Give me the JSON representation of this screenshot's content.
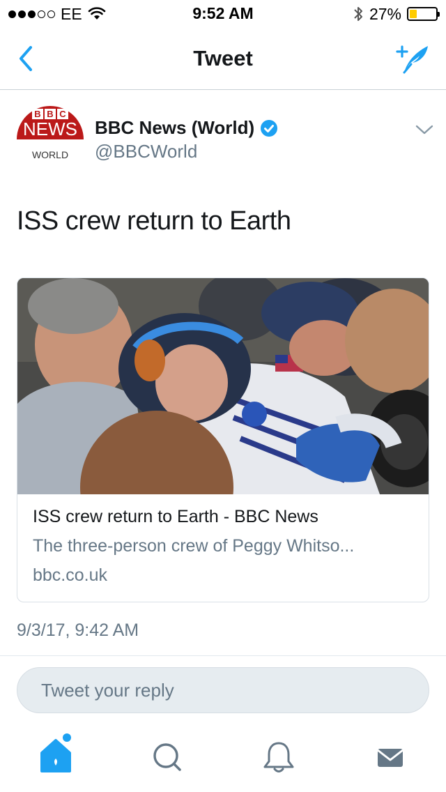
{
  "status_bar": {
    "carrier": "EE",
    "time": "9:52 AM",
    "battery_percent": "27%",
    "battery_level": 0.27,
    "signal_bars_filled": 3,
    "signal_bars_total": 5
  },
  "nav": {
    "title": "Tweet",
    "back_icon": "chevron-left-icon",
    "compose_icon": "compose-tweet-icon",
    "accent_color": "#1da1f2"
  },
  "tweet": {
    "author_name": "BBC News (World)",
    "author_handle": "@BBCWorld",
    "verified": true,
    "avatar": {
      "logo_letters": [
        "B",
        "B",
        "C"
      ],
      "logo_word": "NEWS",
      "logo_sub": "WORLD",
      "color": "#bb1919"
    },
    "text": "ISS crew return to Earth",
    "timestamp": "9/3/17, 9:42 AM"
  },
  "card": {
    "title": "ISS crew return to Earth - BBC News",
    "description": "The three-person crew of Peggy Whitso...",
    "domain": "bbc.co.uk"
  },
  "reply": {
    "placeholder": "Tweet your reply"
  },
  "tab_bar": {
    "items": [
      {
        "name": "home",
        "icon": "home-icon",
        "active": true
      },
      {
        "name": "search",
        "icon": "search-icon",
        "active": false
      },
      {
        "name": "notifications",
        "icon": "bell-icon",
        "active": false
      },
      {
        "name": "messages",
        "icon": "mail-icon",
        "active": false
      }
    ]
  }
}
